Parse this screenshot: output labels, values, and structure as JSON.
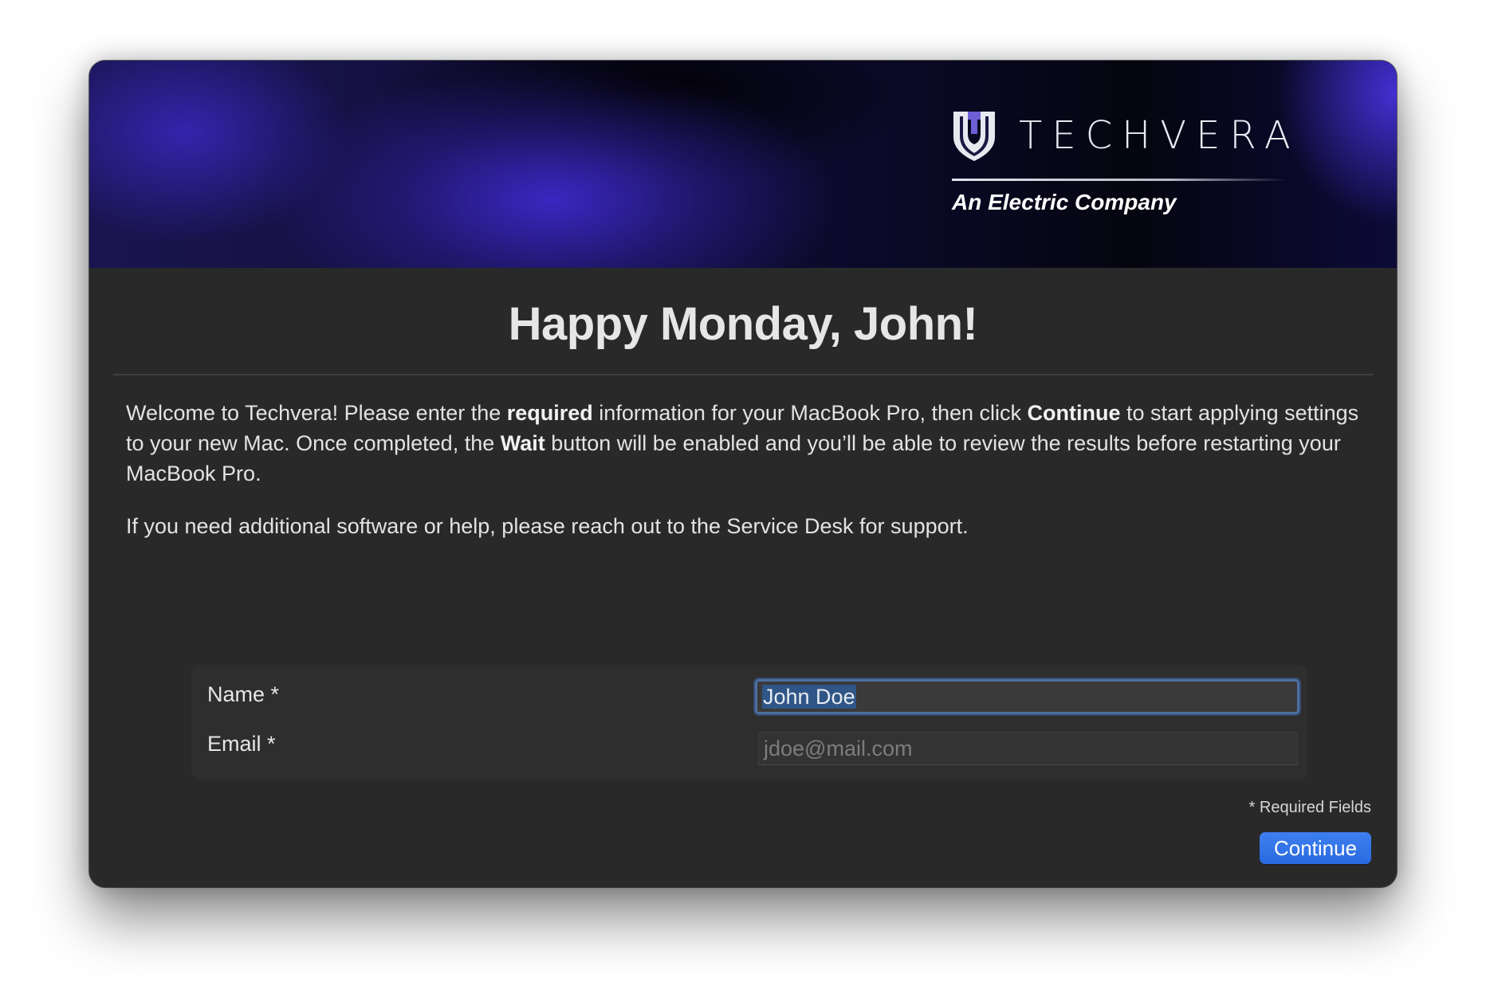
{
  "window": {
    "banner": {
      "brand_name": "TECHVERA",
      "tagline": "An Electric Company",
      "logo_icon": "techvera-shield-icon"
    },
    "greeting": "Happy Monday, John!",
    "intro": {
      "text_1": "Welcome to Techvera! Please enter the ",
      "bold_1": "required",
      "text_2": " information for your MacBook Pro, then click ",
      "bold_2": "Continue",
      "text_3": " to start applying settings to your new Mac. Once completed, the ",
      "bold_3": "Wait",
      "text_4": " button will be enabled and you’ll be able to review the results before restarting your MacBook Pro."
    },
    "help_text": "If you need additional software or help, please reach out to the Service Desk for support.",
    "form": {
      "name_label": "Name *",
      "name_value": "John Doe",
      "email_label": "Email *",
      "email_placeholder": "jdoe@mail.com"
    },
    "required_note": "* Required Fields",
    "continue_label": "Continue"
  },
  "colors": {
    "window_background": "#292929",
    "accent_button": "#2f6fe4",
    "focus_ring": "#4d6fa0",
    "banner_glow": "#3a28c8"
  }
}
